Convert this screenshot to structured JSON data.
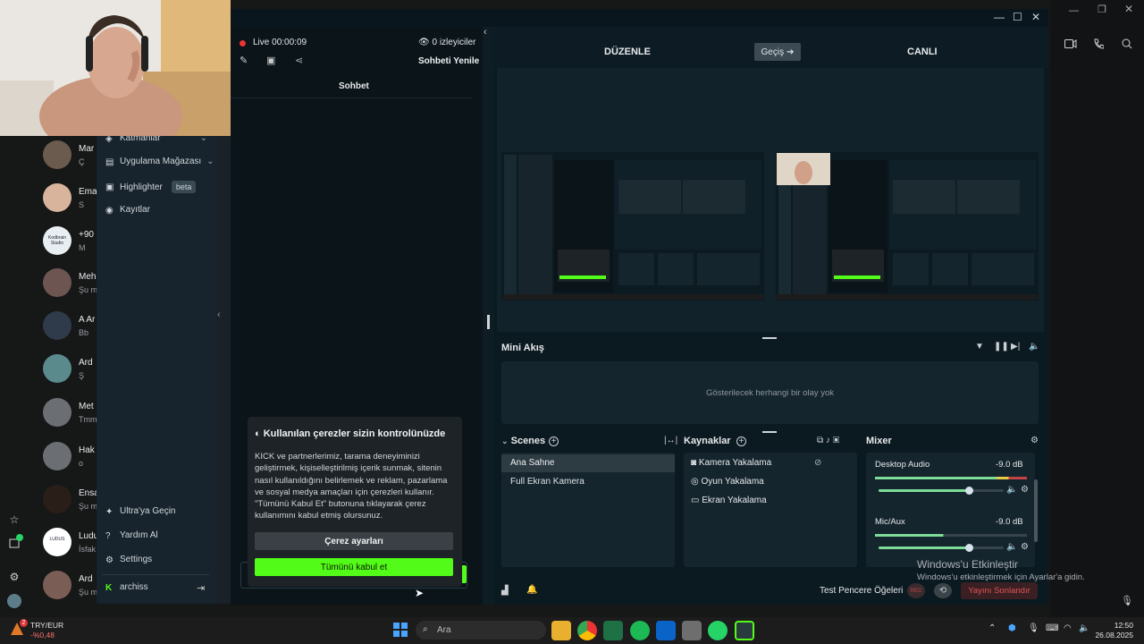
{
  "contacts": [
    {
      "name": "Mar",
      "msg": "Ç",
      "avatar_color": "#6b5b4e"
    },
    {
      "name": "Ema",
      "msg": "S",
      "avatar_color": "#d9b49c"
    },
    {
      "name": "+90",
      "msg": "M",
      "avatar_color": "#e9eef2"
    },
    {
      "name": "Meh",
      "msg": "Şu m",
      "avatar_color": "#6d5552"
    },
    {
      "name": "A Ar",
      "msg": "Bb",
      "avatar_color": "#2f3b4a"
    },
    {
      "name": "Ard",
      "msg": "Ş",
      "avatar_color": "#5a8a8c"
    },
    {
      "name": "Met",
      "msg": "Tmm",
      "avatar_color": "#6b6f73"
    },
    {
      "name": "Hak",
      "msg": "o",
      "avatar_color": "#6b6f73"
    },
    {
      "name": "Ensa",
      "msg": "Şu m",
      "avatar_color": "#2a1e18"
    },
    {
      "name": "Ludu",
      "msg": "İsfak",
      "avatar_color": "#ffffff"
    },
    {
      "name": "Ard",
      "msg": "Şu m",
      "avatar_color": "#7a5e55"
    }
  ],
  "kodbrain_label": "Kodbrain Studio",
  "ludus_label": "LUDUS",
  "sidebar": {
    "top_items": [
      "Katmanlar",
      "Uygulama Mağazası",
      "Highlighter",
      "Kayıtlar"
    ],
    "beta": "beta",
    "bottom_items": [
      "Ultra'ya Geçin",
      "Yardım Al",
      "Settings"
    ],
    "user": "archiss"
  },
  "chat": {
    "live_label": "Live",
    "live_time": "00:00:09",
    "viewers": "0 izleyiciler",
    "refresh": "Sohbeti Yenile",
    "tab": "Sohbet"
  },
  "cookie": {
    "title": "Kullanılan çerezler sizin kontrolünüzde",
    "body": "KICK ve partnerlerimiz, tarama deneyiminizi geliştirmek, kişiselleştirilmiş içerik sunmak, sitenin nasıl kullanıldığını belirlemek ve reklam, pazarlama ve sosyal medya amaçları için çerezleri kullanır. \"Tümünü Kabul Et\" butonuna tıklayarak çerez kullanımını kabul etmiş olursunuz.",
    "settings_btn": "Çerez ayarları",
    "accept_btn": "Tümünü kabul et"
  },
  "studio": {
    "edit": "DÜZENLE",
    "transition": "Geçiş",
    "live": "CANLI",
    "mini_feed": "Mini Akış",
    "no_events": "Gösterilecek herhangi bir olay yok",
    "scenes_title": "Scenes",
    "scenes": [
      "Ana Sahne",
      "Full Ekran Kamera"
    ],
    "sources_title": "Kaynaklar",
    "sources": [
      "Kamera Yakalama",
      "Oyun Yakalama",
      "Ekran Yakalama"
    ],
    "mixer_title": "Mixer",
    "mixer": [
      {
        "name": "Desktop Audio",
        "db": "-9.0 dB",
        "level": 0.72
      },
      {
        "name": "Mic/Aux",
        "db": "-9.0 dB",
        "level": 0.72
      }
    ],
    "test_widgets": "Test Pencere Öğeleri",
    "rec": "REC",
    "end_stream": "Yayını Sonlandır"
  },
  "watermark": {
    "title": "Windows'u Etkinleştir",
    "sub": "Windows'u etkinleştirmek için Ayarlar'a gidin."
  },
  "taskbar": {
    "currency": "TRY/EUR",
    "change": "-%0,48",
    "badge": "2",
    "search": "Ara",
    "time": "12:50",
    "date": "26.08.2025"
  },
  "colors": {
    "accent_green": "#53fc18",
    "end_red": "#c24444",
    "live_dot": "#e33"
  }
}
